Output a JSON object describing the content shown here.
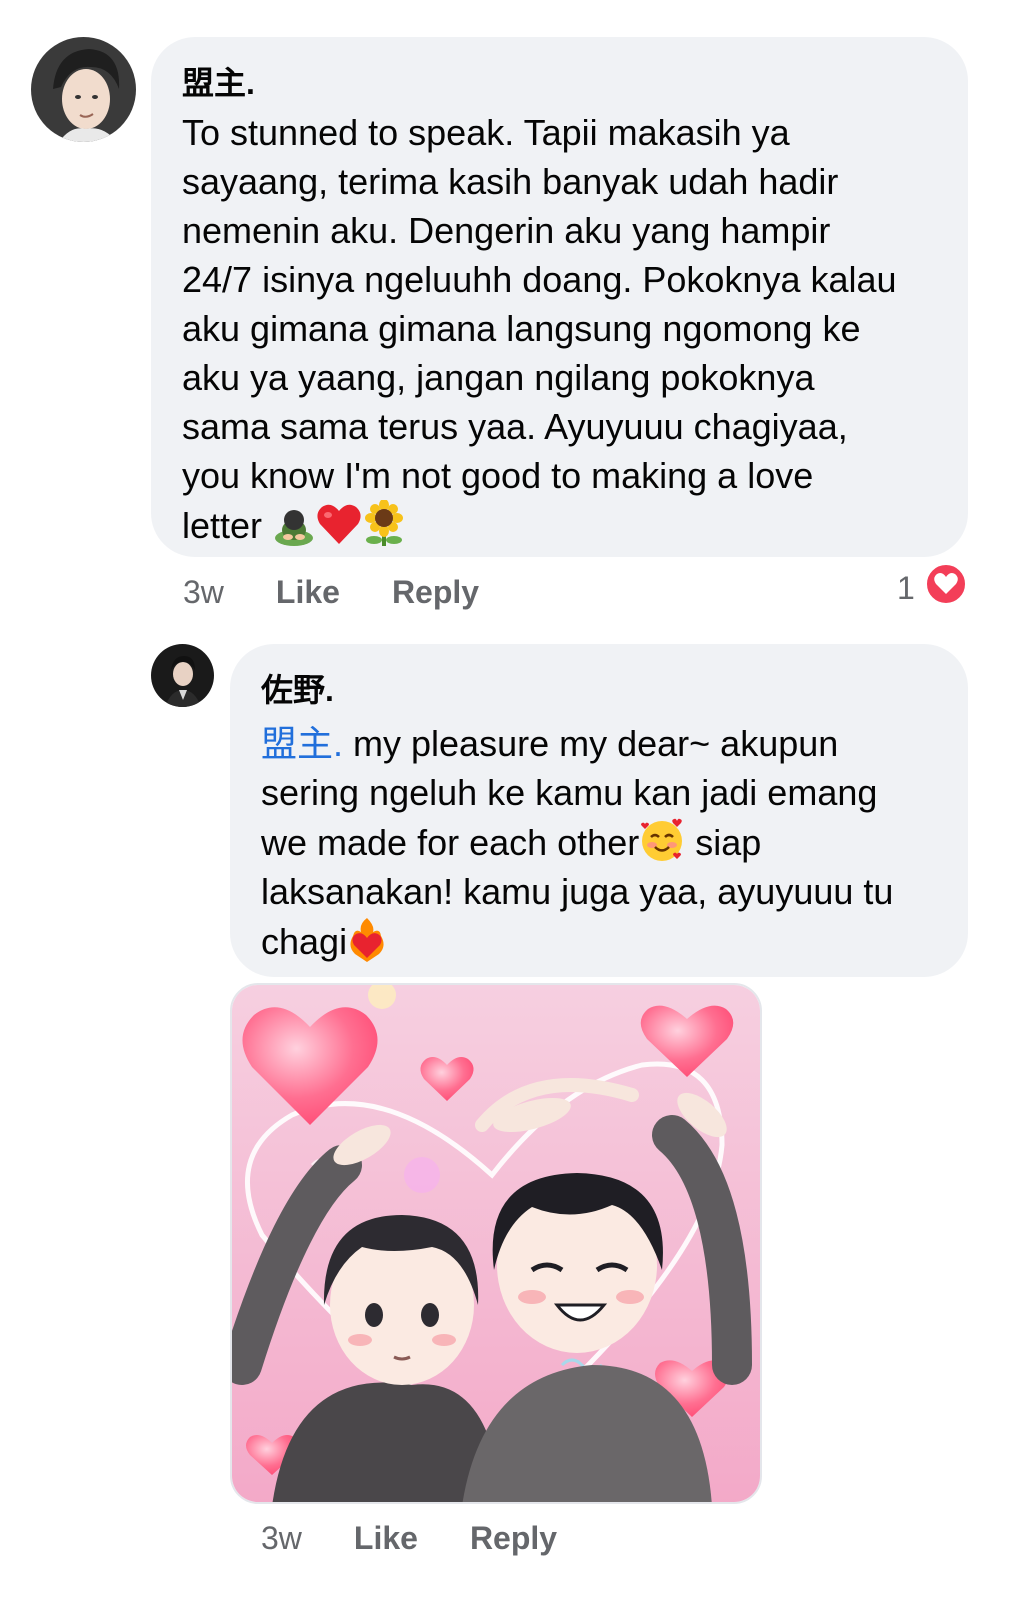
{
  "comment1": {
    "author": "盟主.",
    "lines": [
      "To stunned to speak. Tapii makasih ya",
      "sayaang, terima kasih banyak udah hadir",
      "nemenin aku. Dengerin aku yang hampir",
      "24/7 isinya ngeluuhh doang. Pokoknya kalau",
      "aku gimana gimana langsung ngomong ke",
      "aku ya yaang, jangan ngilang pokoknya",
      "sama sama terus yaa. Ayuyuuu chagiyaa,",
      "you know I'm not good to making a love"
    ],
    "last_line_text": "letter",
    "trailing_emojis": [
      "person-bowing-emoji",
      "red-heart-emoji",
      "sunflower-emoji"
    ],
    "time": "3w",
    "like_label": "Like",
    "reply_label": "Reply",
    "reaction_count": "1",
    "reaction_icon": "love-reaction-icon"
  },
  "reply1": {
    "author": "佐野.",
    "mention": "盟主.",
    "first_line_rest": " my pleasure my dear~ akupun",
    "lines": [
      "sering ngeluh ke kamu kan jadi emang"
    ],
    "line3_text": "we made for each other",
    "line3_emoji": "smiling-face-with-hearts-emoji",
    "line3_rest": " siap",
    "line4": "laksanakan! kamu juga yaa, ayuyuuu tu",
    "last_line_text": "chagi",
    "last_emoji": "heart-on-fire-emoji",
    "image_alt": "illustration of two boys making a heart shape with their arms, surrounded by pink hearts",
    "time": "3w",
    "like_label": "Like",
    "reply_label": "Reply"
  },
  "colors": {
    "bubble": "#f0f2f5",
    "meta_text": "#65676b",
    "mention": "#216fdb",
    "reaction_red": "#f33e58"
  }
}
